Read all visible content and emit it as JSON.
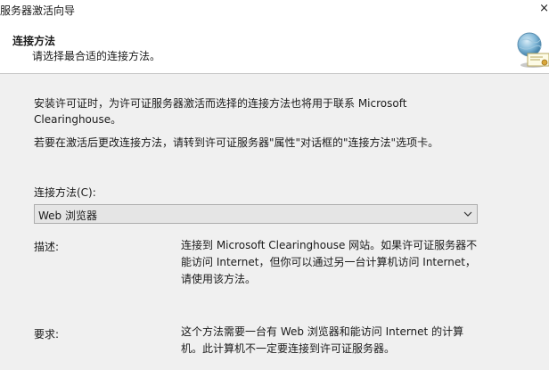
{
  "window": {
    "title": "服务器激活向导",
    "close_glyph": "×"
  },
  "header": {
    "title": "连接方法",
    "subtitle": "请选择最合适的连接方法。",
    "icon": "license-certificate-icon"
  },
  "body": {
    "paragraph1": "安装许可证时，为许可证服务器激活而选择的连接方法也将用于联系 Microsoft Clearinghouse。",
    "paragraph2": "若要在激活后更改连接方法，请转到许可证服务器\"属性\"对话框的\"连接方法\"选项卡。"
  },
  "connection_method": {
    "label": "连接方法(C):",
    "selected": "Web 浏览器"
  },
  "description": {
    "label": "描述:",
    "text": "连接到 Microsoft Clearinghouse 网站。如果许可证服务器不能访问 Internet，但你可以通过另一台计算机访问 Internet，请使用该方法。"
  },
  "requirements": {
    "label": "要求:",
    "text": "这个方法需要一台有 Web 浏览器和能访问 Internet 的计算机。此计算机不一定要连接到许可证服务器。"
  }
}
